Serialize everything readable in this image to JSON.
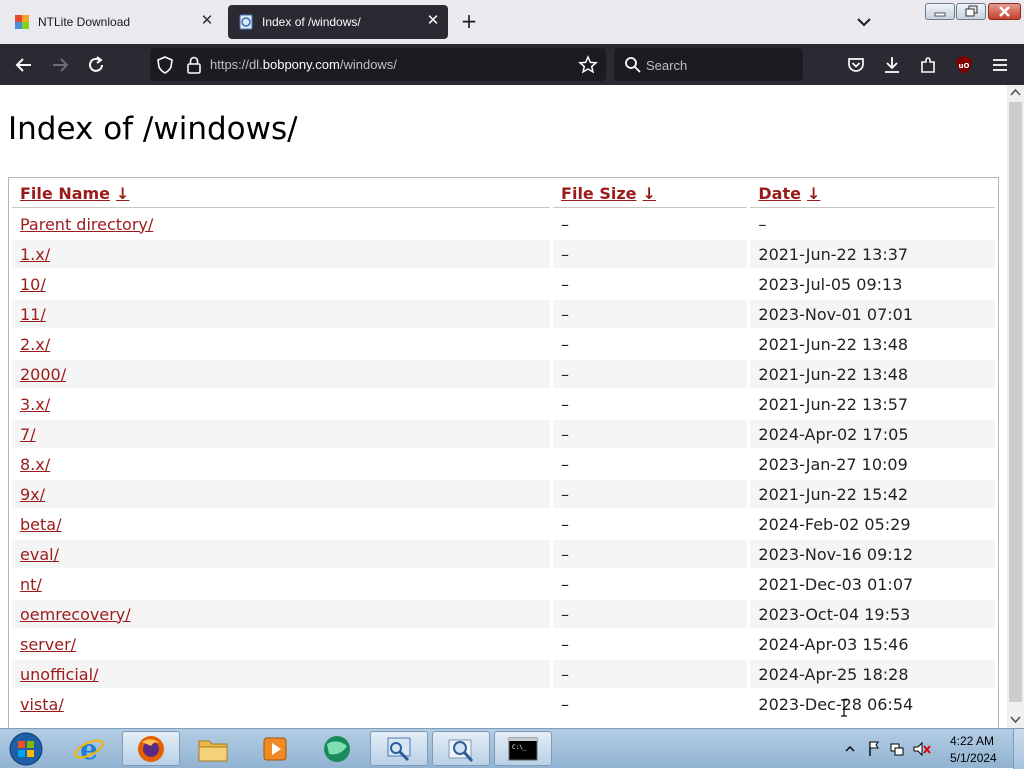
{
  "browser": {
    "tabs": [
      {
        "title": "NTLite Download",
        "active": false
      },
      {
        "title": "Index of /windows/",
        "active": true
      }
    ],
    "url_prefix": "https://dl.",
    "url_host": "bobpony.com",
    "url_path": "/windows/",
    "search_placeholder": "Search"
  },
  "page": {
    "title": "Index of /windows/",
    "columns": {
      "name": "File Name",
      "size": "File Size",
      "date": "Date",
      "sort_arrow": "↓"
    },
    "rows": [
      {
        "name": "Parent directory/",
        "size": "–",
        "date": "–"
      },
      {
        "name": "1.x/",
        "size": "–",
        "date": "2021-Jun-22 13:37"
      },
      {
        "name": "10/",
        "size": "–",
        "date": "2023-Jul-05 09:13"
      },
      {
        "name": "11/",
        "size": "–",
        "date": "2023-Nov-01 07:01"
      },
      {
        "name": "2.x/",
        "size": "–",
        "date": "2021-Jun-22 13:48"
      },
      {
        "name": "2000/",
        "size": "–",
        "date": "2021-Jun-22 13:48"
      },
      {
        "name": "3.x/",
        "size": "–",
        "date": "2021-Jun-22 13:57"
      },
      {
        "name": "7/",
        "size": "–",
        "date": "2024-Apr-02 17:05"
      },
      {
        "name": "8.x/",
        "size": "–",
        "date": "2023-Jan-27 10:09"
      },
      {
        "name": "9x/",
        "size": "–",
        "date": "2021-Jun-22 15:42"
      },
      {
        "name": "beta/",
        "size": "–",
        "date": "2024-Feb-02 05:29"
      },
      {
        "name": "eval/",
        "size": "–",
        "date": "2023-Nov-16 09:12"
      },
      {
        "name": "nt/",
        "size": "–",
        "date": "2021-Dec-03 01:07"
      },
      {
        "name": "oemrecovery/",
        "size": "–",
        "date": "2023-Oct-04 19:53"
      },
      {
        "name": "server/",
        "size": "–",
        "date": "2024-Apr-03 15:46"
      },
      {
        "name": "unofficial/",
        "size": "–",
        "date": "2024-Apr-25 18:28"
      },
      {
        "name": "vista/",
        "size": "–",
        "date": "2023-Dec-28 06:54"
      }
    ]
  },
  "taskbar": {
    "items": [
      "internet-explorer",
      "firefox",
      "file-explorer",
      "media-player",
      "globe-app",
      "network-tool",
      "search-tool",
      "command-prompt"
    ],
    "active": [
      "firefox",
      "network-tool",
      "search-tool",
      "command-prompt"
    ],
    "clock_time": "4:22 AM",
    "clock_date": "5/1/2024"
  },
  "colors": {
    "link": "#9b1b1b",
    "toolbar": "#2b2a33",
    "taskbar": "#a7c3de"
  }
}
